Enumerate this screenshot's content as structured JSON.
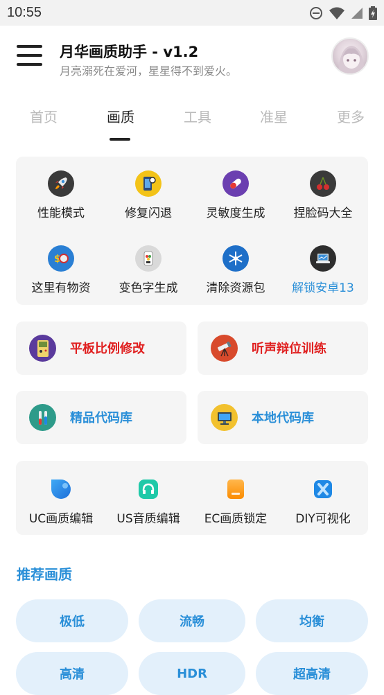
{
  "status_bar": {
    "time": "10:55"
  },
  "header": {
    "title": "月华画质助手 - v1.2",
    "subtitle": "月亮溺死在爱河，星星得不到爱火。"
  },
  "tabs": [
    {
      "label": "首页",
      "active": false
    },
    {
      "label": "画质",
      "active": true
    },
    {
      "label": "工具",
      "active": false
    },
    {
      "label": "准星",
      "active": false
    },
    {
      "label": "更多",
      "active": false
    }
  ],
  "tools_grid": [
    {
      "label": "性能模式",
      "icon": "rocket-icon"
    },
    {
      "label": "修复闪退",
      "icon": "phone-gear-icon"
    },
    {
      "label": "灵敏度生成",
      "icon": "pill-icon"
    },
    {
      "label": "捏脸码大全",
      "icon": "cherry-icon"
    },
    {
      "label": "这里有物资",
      "icon": "coin-icon"
    },
    {
      "label": "变色字生成",
      "icon": "palette-phone-icon"
    },
    {
      "label": "清除资源包",
      "icon": "snowflake-icon"
    },
    {
      "label": "解锁安卓13",
      "icon": "laptop-icon"
    }
  ],
  "feature_cards": [
    {
      "label": "平板比例修改",
      "icon": "gameboy-icon",
      "color": "#e02020"
    },
    {
      "label": "听声辩位训练",
      "icon": "telescope-icon",
      "color": "#e02020"
    },
    {
      "label": "精品代码库",
      "icon": "test-tubes-icon",
      "color": "#2a8fd8"
    },
    {
      "label": "本地代码库",
      "icon": "computer-icon",
      "color": "#2a8fd8"
    }
  ],
  "editors": [
    {
      "label": "UC画质编辑",
      "icon": "bubble-icon"
    },
    {
      "label": "US音质编辑",
      "icon": "headphone-icon"
    },
    {
      "label": "EC画质锁定",
      "icon": "card-icon"
    },
    {
      "label": "DIY可视化",
      "icon": "x-shape-icon"
    }
  ],
  "recommend": {
    "title": "推荐画质",
    "options": [
      "极低",
      "流畅",
      "均衡",
      "高清",
      "HDR",
      "超高清"
    ]
  },
  "colors": {
    "accent": "#2a8fd8",
    "danger": "#e02020"
  }
}
